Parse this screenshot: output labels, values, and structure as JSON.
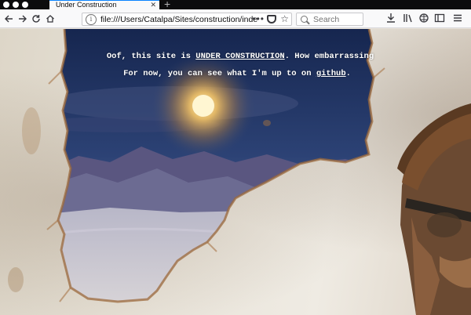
{
  "browser": {
    "tab_title": "Under Construction",
    "tab_close": "✕",
    "new_tab": "+",
    "url": "file:///Users/Catalpa/Sites/construction/index.h",
    "search_placeholder": "Search",
    "icons": [
      "back-icon",
      "forward-icon",
      "reload-icon",
      "home-icon",
      "page-info-icon",
      "page-actions-icon",
      "pocket-icon",
      "bookmark-star-icon",
      "search-icon",
      "download-icon",
      "library-icon",
      "reader-icon",
      "sidebar-icon",
      "menu-icon"
    ]
  },
  "page": {
    "line1_prefix": "Oof, this site is ",
    "line1_link": "UNDER CONSTRUCTION",
    "line1_suffix": ". How embarrassing",
    "line2_prefix": "For now, you can see what I'm up to on ",
    "line2_link": "github",
    "line2_suffix": "."
  },
  "colors": {
    "chrome_dark": "#0c0c0d",
    "toolbar": "#f9f9fa",
    "accent": "#0a84ff",
    "night_sky": "#1d2f5c",
    "moon": "#fff3c4",
    "wall": "#e9e4da"
  }
}
